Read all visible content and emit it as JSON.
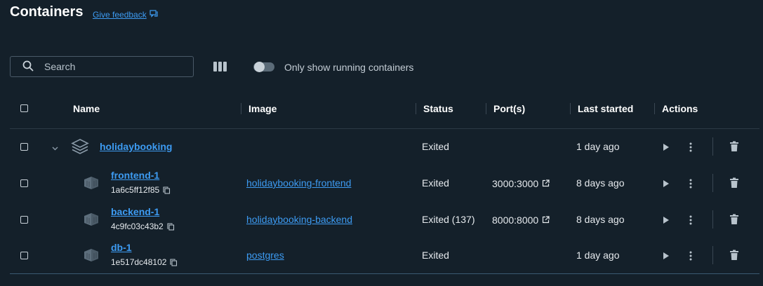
{
  "header": {
    "title": "Containers",
    "feedback_label": "Give feedback"
  },
  "toolbar": {
    "search_placeholder": "Search",
    "toggle_label": "Only show running containers"
  },
  "table": {
    "columns": [
      "Name",
      "Image",
      "Status",
      "Port(s)",
      "Last started",
      "Actions"
    ],
    "group": {
      "name": "holidaybooking",
      "status": "Exited",
      "last_started": "1 day ago"
    },
    "rows": [
      {
        "name": "frontend-1",
        "id": "1a6c5ff12f85",
        "image": "holidaybooking-frontend",
        "status": "Exited",
        "port": "3000:3000",
        "last_started": "8 days ago"
      },
      {
        "name": "backend-1",
        "id": "4c9fc03c43b2",
        "image": "holidaybooking-backend",
        "status": "Exited (137)",
        "port": "8000:8000",
        "last_started": "8 days ago"
      },
      {
        "name": "db-1",
        "id": "1e517dc48102",
        "image": "postgres",
        "status": "Exited",
        "port": "",
        "last_started": "1 day ago"
      }
    ]
  },
  "icons": {
    "search": "search-icon",
    "feedback": "feedback-icon",
    "columns": "columns-icon",
    "stack": "stack-icon",
    "container": "container-icon",
    "copy": "copy-icon",
    "external_link": "external-link-icon",
    "play": "play-icon",
    "more": "more-vertical-icon",
    "delete": "trash-icon",
    "chevron": "chevron-down-icon"
  },
  "colors": {
    "background": "#14202a",
    "link": "#3d9bf2",
    "text": "#e6eaee",
    "icon": "#8a9aa8"
  }
}
